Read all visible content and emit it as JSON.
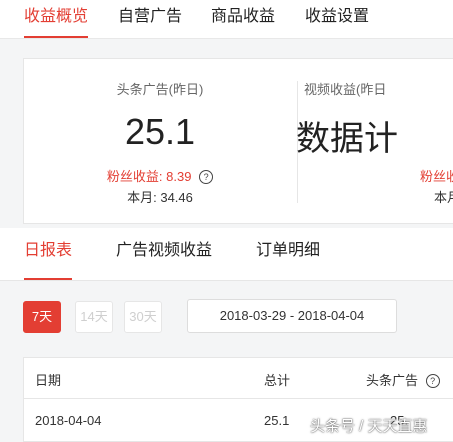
{
  "top_tabs": [
    "收益概览",
    "自营广告",
    "商品收益",
    "收益设置"
  ],
  "cards": [
    {
      "title": "头条广告(昨日)",
      "value": "25.1",
      "fans_label": "粉丝收益:",
      "fans_value": "8.39",
      "month_label": "本月:",
      "month_value": "34.46"
    },
    {
      "title": "视频收益(昨日",
      "value": "数据计",
      "fans_label": "粉丝收",
      "month_label": "本月:"
    }
  ],
  "sub_tabs": [
    "日报表",
    "广告视频收益",
    "订单明细"
  ],
  "ranges": [
    "7天",
    "14天",
    "30天"
  ],
  "date_range": "2018-03-29  -  2018-04-04",
  "table": {
    "headers": [
      "日期",
      "总计",
      "头条广告"
    ],
    "row": [
      "2018-04-04",
      "25.1",
      "25."
    ]
  },
  "watermark": "头条号 / 天天直惠",
  "colors": {
    "accent": "#e33e33"
  },
  "icons": {
    "help": "question-circle-icon"
  }
}
